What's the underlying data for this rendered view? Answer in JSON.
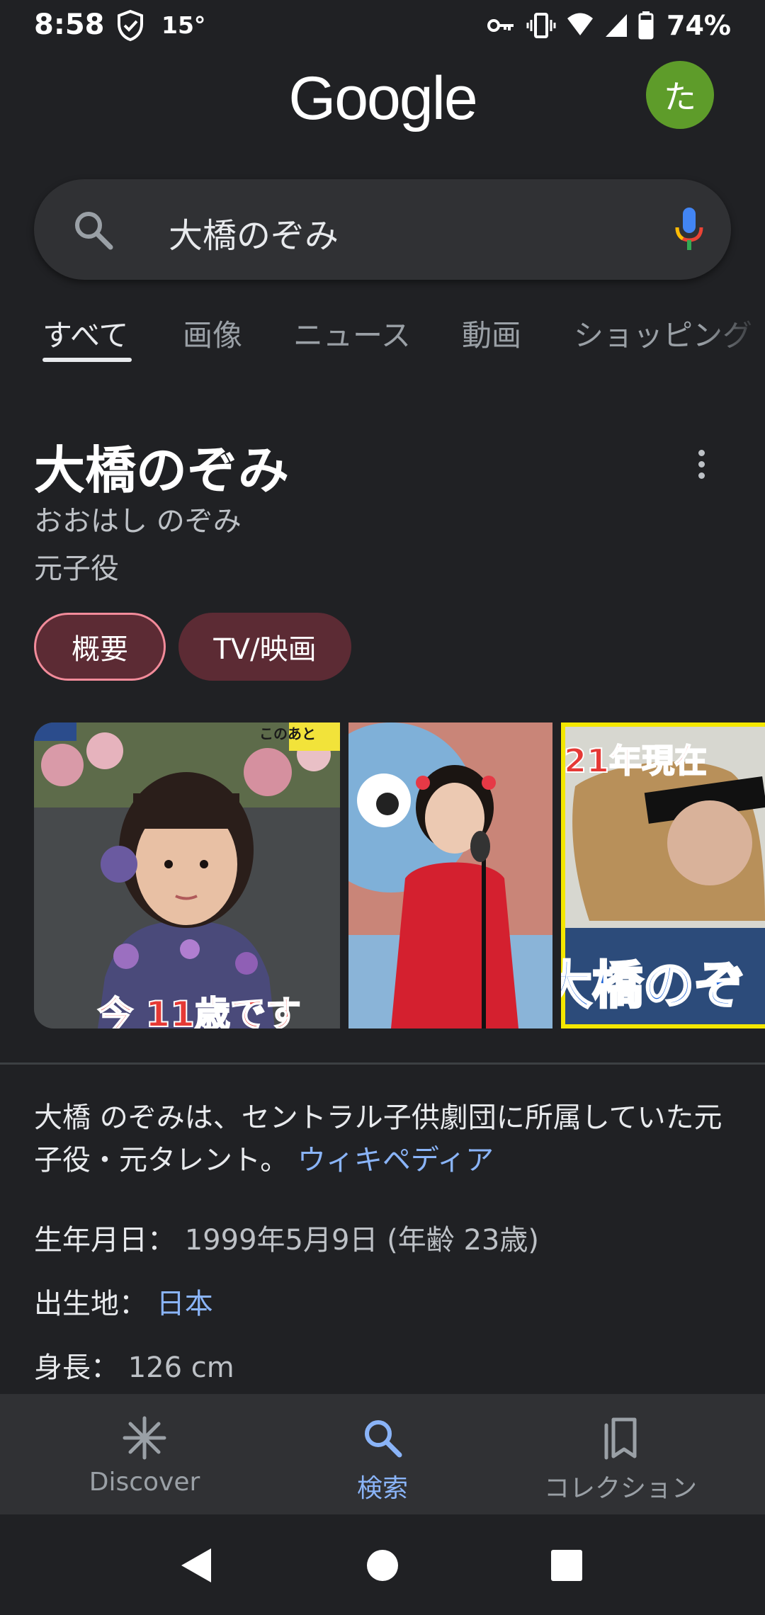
{
  "status_bar": {
    "time": "8:58",
    "temperature": "15°",
    "battery": "74%"
  },
  "header": {
    "logo": "Google",
    "avatar_initial": "た"
  },
  "search": {
    "query": "大橋のぞみ"
  },
  "tabs": [
    "すべて",
    "画像",
    "ニュース",
    "動画",
    "ショッピング"
  ],
  "knowledge_panel": {
    "title": "大橋のぞみ",
    "reading": "おおはし のぞみ",
    "description": "元子役",
    "chips": [
      "概要",
      "TV/映画"
    ],
    "image_captions": [
      "今 11歳です",
      "21年現在",
      "大橋のぞ"
    ],
    "image_badges": [
      "このあと"
    ],
    "summary_text": "大橋 のぞみは、セントラル子供劇団に所属していた元子役・元タレント。",
    "summary_source": "ウィキペディア",
    "facts": [
      {
        "label": "生年月日：",
        "value": "1999年5月9日 (年齢 23歳)"
      },
      {
        "label": "出生地：",
        "value": "日本"
      },
      {
        "label": "身長：",
        "value": "126 cm"
      }
    ]
  },
  "bottom_nav": [
    {
      "label": "Discover",
      "icon": "asterisk-icon"
    },
    {
      "label": "検索",
      "icon": "search-icon"
    },
    {
      "label": "コレクション",
      "icon": "collections-icon"
    }
  ],
  "colors": {
    "background": "#202124",
    "accent": "#8ab4f8",
    "chip": "#5c2b34",
    "avatar": "#5e9c2a"
  }
}
